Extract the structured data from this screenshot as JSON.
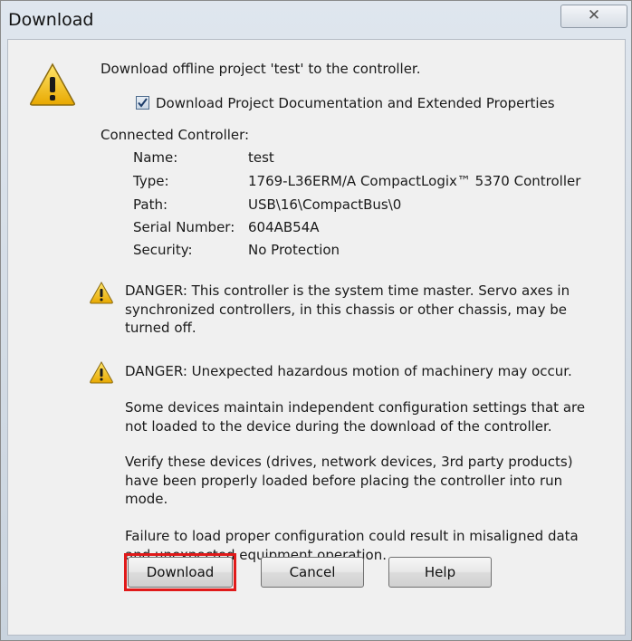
{
  "window": {
    "title": "Download",
    "close_glyph": "✕"
  },
  "header": {
    "message": "Download offline project 'test' to the controller.",
    "checkbox_label": "Download Project Documentation and Extended Properties",
    "checkbox_checked": true
  },
  "controller": {
    "heading": "Connected Controller:",
    "fields": [
      {
        "label": "Name:",
        "value": "test"
      },
      {
        "label": "Type:",
        "value": "1769-L36ERM/A CompactLogix™ 5370 Controller"
      },
      {
        "label": "Path:",
        "value": "USB\\16\\CompactBus\\0"
      },
      {
        "label": "Serial Number:",
        "value": "604AB54A"
      },
      {
        "label": "Security:",
        "value": "No Protection"
      }
    ]
  },
  "warnings": {
    "danger1": [
      "DANGER: This controller is the system time master.  Servo axes in",
      "synchronized controllers, in this chassis or other chassis, may be",
      "turned off."
    ],
    "danger2": "DANGER: Unexpected hazardous motion of machinery may occur.",
    "para1": [
      "Some devices maintain independent configuration settings that are",
      "not loaded to the device during the download of the controller."
    ],
    "para2": [
      "Verify these devices (drives, network devices, 3rd party products)",
      "have been properly loaded before placing the controller into run",
      "mode."
    ],
    "para3": [
      "Failure to load proper configuration could result in misaligned data",
      "and unexpected equipment operation."
    ]
  },
  "buttons": {
    "download": "Download",
    "cancel": "Cancel",
    "help": "Help"
  },
  "colors": {
    "highlight": "#e01a1a",
    "warning_yellow": "#f5c518"
  }
}
